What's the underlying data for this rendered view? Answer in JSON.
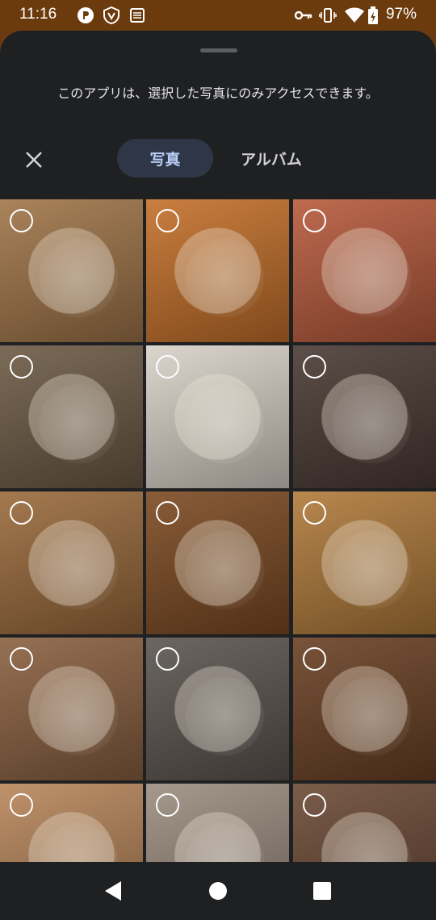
{
  "status_bar": {
    "time": "11:16",
    "battery_percent": "97%",
    "left_icons": [
      "app-p-icon",
      "shield-v-icon",
      "news-icon"
    ],
    "right_icons": [
      "key-icon",
      "vibrate-icon",
      "wifi-icon",
      "battery-charging-icon"
    ]
  },
  "sheet": {
    "notice": "このアプリは、選択した写真にのみアクセスできます。",
    "tabs": [
      {
        "label": "写真",
        "selected": true
      },
      {
        "label": "アルバム",
        "selected": false
      }
    ]
  },
  "photos": [
    {
      "name": "pancakes-eggs",
      "color": "#a07548"
    },
    {
      "name": "burgers",
      "color": "#c4702a"
    },
    {
      "name": "tomato-noodle-bowl",
      "color": "#b75a3c"
    },
    {
      "name": "rice-salmon-egg",
      "color": "#6d5a45"
    },
    {
      "name": "bento-box",
      "color": "#d8d2c8"
    },
    {
      "name": "steak-wine",
      "color": "#4a3a34"
    },
    {
      "name": "chicken-soup",
      "color": "#9a6a3c"
    },
    {
      "name": "wood-plate-rice",
      "color": "#7c4a22"
    },
    {
      "name": "fish-potatoes",
      "color": "#b07a3a"
    },
    {
      "name": "tomato-soup-plate",
      "color": "#8a6040"
    },
    {
      "name": "fried-fish-dark-plate",
      "color": "#5c5550"
    },
    {
      "name": "grilled-fish-eggs",
      "color": "#6a4024"
    },
    {
      "name": "beet-dish",
      "color": "#b8865a"
    },
    {
      "name": "flatbread",
      "color": "#9c8d80"
    },
    {
      "name": "base-bread-pack",
      "color": "#6c4a36"
    }
  ],
  "colors": {
    "status_bar_bg": "#6b3b0d",
    "sheet_bg": "#1f2022",
    "tab_selected_bg": "#2f3645",
    "tab_selected_text": "#b9cdf5"
  },
  "nav": [
    "back-icon",
    "home-icon",
    "recents-icon"
  ]
}
